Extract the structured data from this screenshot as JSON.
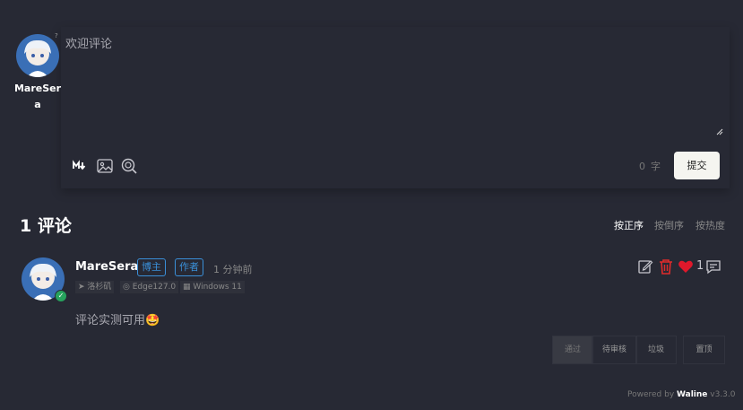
{
  "composer": {
    "user_name": "MareSera",
    "help_mark": "?",
    "placeholder": "欢迎评论",
    "toolbar": [
      "markdown-icon",
      "image-icon",
      "emoji-search-icon"
    ],
    "word_count_value": "0",
    "word_count_unit": "字",
    "submit_label": "提交"
  },
  "list": {
    "count_title": "1 评论",
    "sort": [
      "按正序",
      "按倒序",
      "按热度"
    ],
    "active_sort": "按正序"
  },
  "comment": {
    "nick": "MareSera",
    "badges": [
      "博主",
      "作者"
    ],
    "time": "1 分钟前",
    "meta": [
      "洛杉矶",
      "Edge127.0",
      "Windows 11"
    ],
    "content": "评论实测可用",
    "emoji": "🤩",
    "like_count": "1",
    "admin_actions": [
      "通过",
      "待审核",
      "垃圾",
      "置顶"
    ]
  },
  "footer": {
    "prefix": "Powered by ",
    "brand": "Waline",
    "version": " v3.3.0"
  },
  "colors": {
    "background": "#272934",
    "badge": "#3a8fd8",
    "delete": "#e02b2b",
    "like": "#e0182b",
    "verified": "#27a35d"
  }
}
